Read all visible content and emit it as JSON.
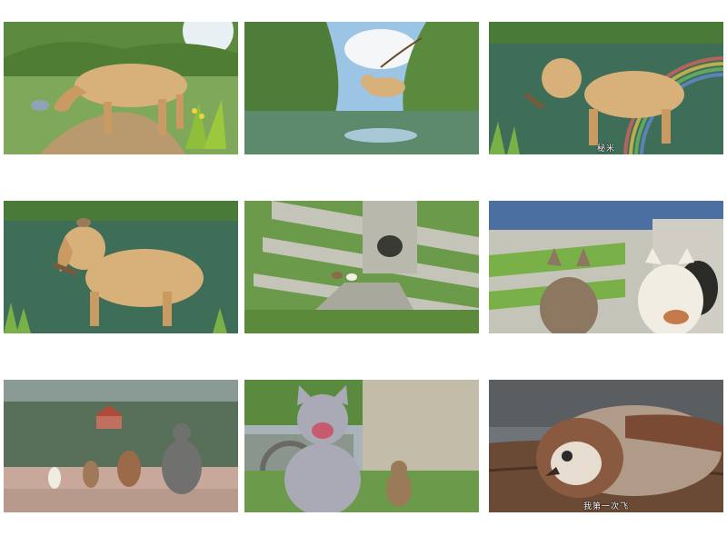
{
  "grid": {
    "rows": 3,
    "columns": 3
  },
  "frames": [
    {
      "subtitle": ""
    },
    {
      "subtitle": ""
    },
    {
      "subtitle": "秘米"
    },
    {
      "subtitle": ""
    },
    {
      "subtitle": ""
    },
    {
      "subtitle": ""
    },
    {
      "subtitle": ""
    },
    {
      "subtitle": ""
    },
    {
      "subtitle": "我第一次飞"
    }
  ],
  "colors": {
    "dog_fur": "#d8b07a",
    "water": "#3f6e58",
    "grass": "#6a9a3a",
    "sky": "#9cc4e4",
    "concrete": "#b8b8ac",
    "cat_gray": "#a9aab6",
    "mouse_brown": "#9b7a58",
    "bird_brown": "#8a5a40"
  }
}
